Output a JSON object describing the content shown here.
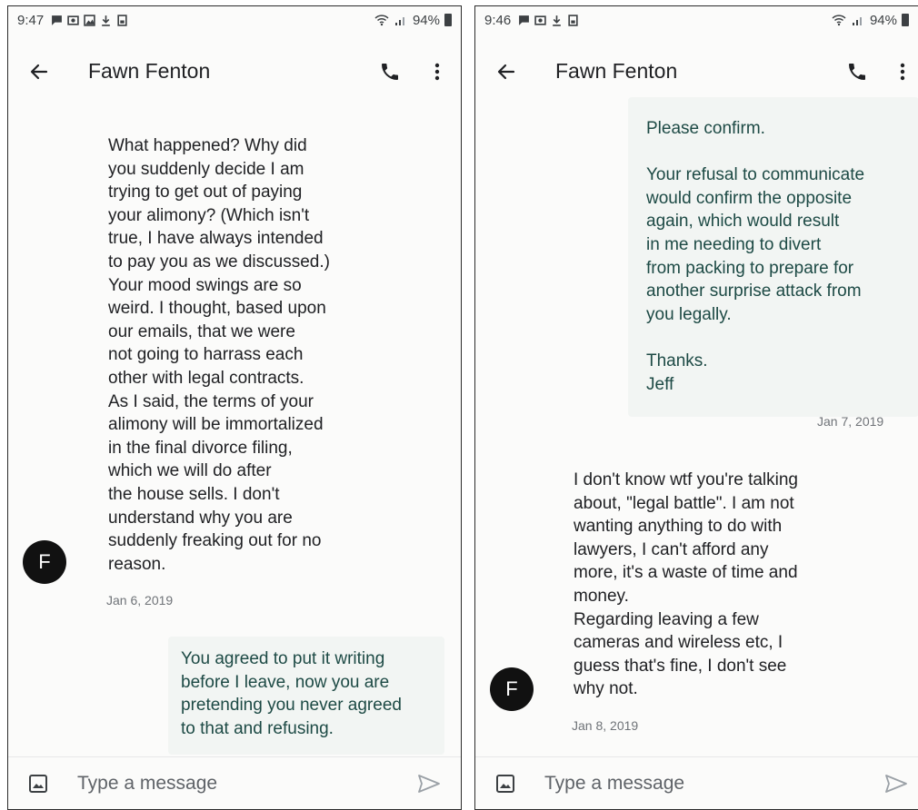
{
  "left": {
    "status": {
      "time": "9:47",
      "battery": "94%"
    },
    "header": {
      "contact": "Fawn Fenton"
    },
    "messages": [
      {
        "text": "What happened? Why did\nyou suddenly decide I am\ntrying to get out of paying\nyour alimony? (Which isn't\ntrue, I have always intended\nto pay you as we discussed.)\nYour mood swings are so\nweird. I thought, based upon\nour emails, that we were\nnot going to harrass each\nother with legal contracts.\nAs I said, the terms of your\nalimony will be immortalized\nin the final divorce filing,\nwhich we will do after\nthe house sells. I don't\nunderstand why you are\nsuddenly freaking out for no\nreason.",
        "date": "Jan 6, 2019",
        "avatar": "F"
      },
      {
        "text": "You agreed to put it writing\nbefore I leave, now you are\npretending you never agreed\nto that and refusing."
      }
    ],
    "compose": {
      "placeholder": "Type a message"
    }
  },
  "right": {
    "status": {
      "time": "9:46",
      "battery": "94%"
    },
    "header": {
      "contact": "Fawn Fenton"
    },
    "messages": [
      {
        "text": "Please confirm.\n\nYour refusal to communicate\nwould confirm the opposite\nagain, which would result\nin me needing to divert\nfrom packing to prepare for\nanother surprise attack from\nyou legally.\n\nThanks.\nJeff",
        "date": "Jan 7, 2019"
      },
      {
        "text": "I don't know wtf you're talking\nabout, \"legal battle\". I am not\nwanting anything to do with\nlawyers, I can't afford any\nmore, it's a waste of time and\nmoney.\nRegarding leaving a few\ncameras and wireless etc, I\nguess that's fine, I don't see\nwhy not.",
        "date": "Jan 8, 2019",
        "avatar": "F"
      }
    ],
    "compose": {
      "placeholder": "Type a message"
    }
  }
}
